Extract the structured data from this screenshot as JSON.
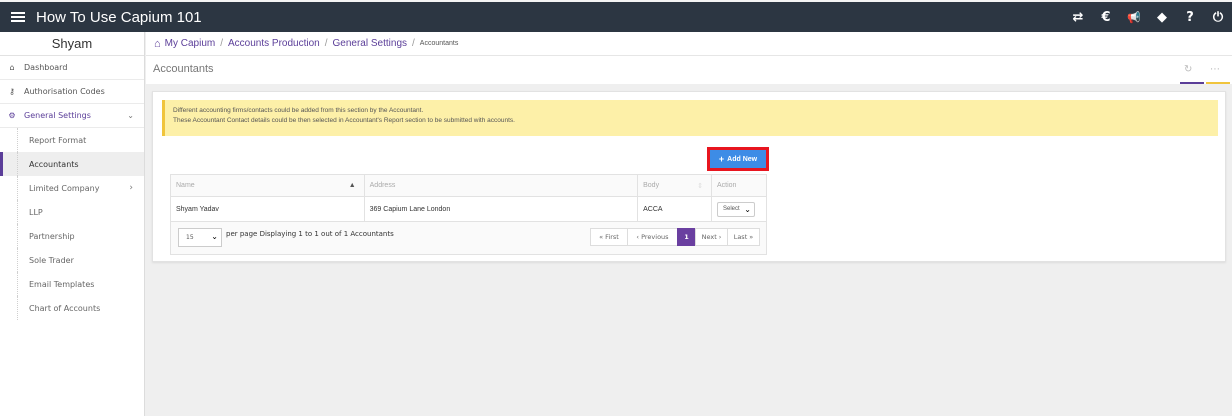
{
  "app": {
    "title": "How To Use Capium 101"
  },
  "topbar": {
    "icons": [
      {
        "name": "switch-arrows-icon",
        "glyph": "⇄"
      },
      {
        "name": "capium-logo-icon",
        "glyph": "€"
      },
      {
        "name": "announcement-icon",
        "glyph": "📢"
      },
      {
        "name": "tag-icon",
        "glyph": "◆"
      },
      {
        "name": "help-icon",
        "glyph": "?"
      },
      {
        "name": "power-icon",
        "glyph": "⏻"
      }
    ]
  },
  "sidebar": {
    "user": "Shyam",
    "items": [
      {
        "label": "Dashboard",
        "icon": "home-icon"
      },
      {
        "label": "Authorisation Codes",
        "icon": "key-icon"
      },
      {
        "label": "General Settings",
        "icon": "cogs-icon"
      }
    ],
    "subitems": [
      {
        "label": "Report Format"
      },
      {
        "label": "Accountants"
      },
      {
        "label": "Limited Company"
      },
      {
        "label": "LLP"
      },
      {
        "label": "Partnership"
      },
      {
        "label": "Sole Trader"
      },
      {
        "label": "Email Templates"
      },
      {
        "label": "Chart of Accounts"
      }
    ]
  },
  "breadcrumb": {
    "items": [
      "My Capium",
      "Accounts Production",
      "General Settings"
    ],
    "current": "Accountants",
    "separator": "/"
  },
  "page": {
    "title": "Accountants"
  },
  "alert": {
    "line1": "Different accounting firms/contacts could be added from this section by the Accountant.",
    "line2": "These Accountant Contact details could be then selected in Accountant's Report section to be submitted with accounts."
  },
  "toolbar": {
    "add_label": "Add New"
  },
  "table": {
    "columns": [
      "Name",
      "Address",
      "Body",
      "Action"
    ],
    "rows": [
      {
        "name": "Shyam Yadav",
        "address": "369 Capium Lane London",
        "body": "ACCA",
        "action": "Select"
      }
    ]
  },
  "pagination": {
    "per_page": "15",
    "per_page_label": "per page",
    "summary": "Displaying 1 to 1 out of 1 Accountants",
    "first": "« First",
    "previous": "‹ Previous",
    "current": "1",
    "next": "Next ›",
    "last": "Last »"
  },
  "colors": {
    "topbar": "#2c3642",
    "accent": "#5b3e99",
    "add_button": "#3d8ce6",
    "highlight_border": "#e8151f",
    "alert_bg": "#fdf0a8"
  }
}
